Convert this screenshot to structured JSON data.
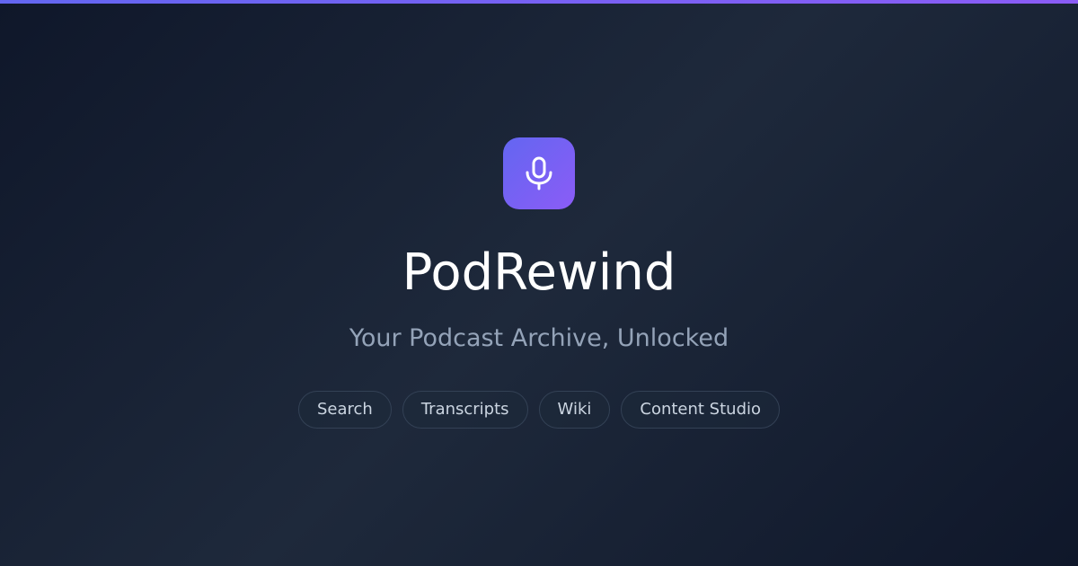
{
  "brand": {
    "name": "PodRewind",
    "tagline": "Your Podcast Archive, Unlocked",
    "logo_icon": "microphone-icon",
    "accent_start": "#6366f1",
    "accent_end": "#8b5cf6"
  },
  "features": [
    {
      "label": "Search"
    },
    {
      "label": "Transcripts"
    },
    {
      "label": "Wiki"
    },
    {
      "label": "Content Studio"
    }
  ],
  "colors": {
    "background": "#0f172a",
    "background_mid": "#1e293b",
    "title": "#ffffff",
    "subtitle": "#94a3b8",
    "pill_border": "#334155",
    "pill_text": "#cbd5e1"
  }
}
